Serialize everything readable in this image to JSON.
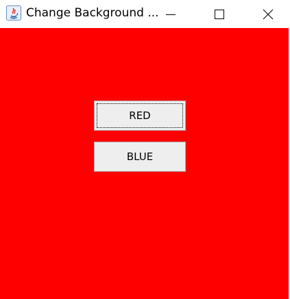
{
  "window": {
    "title": "Change Background ...",
    "app_icon": "java-icon",
    "controls": {
      "minimize_icon": "minimize-icon",
      "maximize_icon": "maximize-icon",
      "close_icon": "close-icon"
    }
  },
  "content": {
    "background_color": "#ff0000",
    "buttons": [
      {
        "label": "RED",
        "focused": true
      },
      {
        "label": "BLUE",
        "focused": false
      }
    ]
  }
}
